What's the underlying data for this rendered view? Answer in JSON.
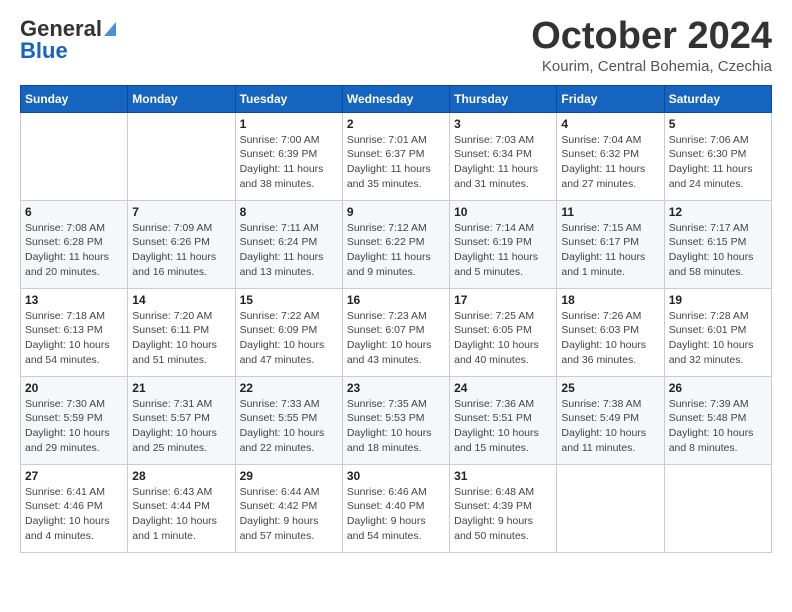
{
  "header": {
    "logo_line1": "General",
    "logo_line2": "Blue",
    "month": "October 2024",
    "location": "Kourim, Central Bohemia, Czechia"
  },
  "weekdays": [
    "Sunday",
    "Monday",
    "Tuesday",
    "Wednesday",
    "Thursday",
    "Friday",
    "Saturday"
  ],
  "weeks": [
    [
      {
        "day": "",
        "info": ""
      },
      {
        "day": "",
        "info": ""
      },
      {
        "day": "1",
        "info": "Sunrise: 7:00 AM\nSunset: 6:39 PM\nDaylight: 11 hours and 38 minutes."
      },
      {
        "day": "2",
        "info": "Sunrise: 7:01 AM\nSunset: 6:37 PM\nDaylight: 11 hours and 35 minutes."
      },
      {
        "day": "3",
        "info": "Sunrise: 7:03 AM\nSunset: 6:34 PM\nDaylight: 11 hours and 31 minutes."
      },
      {
        "day": "4",
        "info": "Sunrise: 7:04 AM\nSunset: 6:32 PM\nDaylight: 11 hours and 27 minutes."
      },
      {
        "day": "5",
        "info": "Sunrise: 7:06 AM\nSunset: 6:30 PM\nDaylight: 11 hours and 24 minutes."
      }
    ],
    [
      {
        "day": "6",
        "info": "Sunrise: 7:08 AM\nSunset: 6:28 PM\nDaylight: 11 hours and 20 minutes."
      },
      {
        "day": "7",
        "info": "Sunrise: 7:09 AM\nSunset: 6:26 PM\nDaylight: 11 hours and 16 minutes."
      },
      {
        "day": "8",
        "info": "Sunrise: 7:11 AM\nSunset: 6:24 PM\nDaylight: 11 hours and 13 minutes."
      },
      {
        "day": "9",
        "info": "Sunrise: 7:12 AM\nSunset: 6:22 PM\nDaylight: 11 hours and 9 minutes."
      },
      {
        "day": "10",
        "info": "Sunrise: 7:14 AM\nSunset: 6:19 PM\nDaylight: 11 hours and 5 minutes."
      },
      {
        "day": "11",
        "info": "Sunrise: 7:15 AM\nSunset: 6:17 PM\nDaylight: 11 hours and 1 minute."
      },
      {
        "day": "12",
        "info": "Sunrise: 7:17 AM\nSunset: 6:15 PM\nDaylight: 10 hours and 58 minutes."
      }
    ],
    [
      {
        "day": "13",
        "info": "Sunrise: 7:18 AM\nSunset: 6:13 PM\nDaylight: 10 hours and 54 minutes."
      },
      {
        "day": "14",
        "info": "Sunrise: 7:20 AM\nSunset: 6:11 PM\nDaylight: 10 hours and 51 minutes."
      },
      {
        "day": "15",
        "info": "Sunrise: 7:22 AM\nSunset: 6:09 PM\nDaylight: 10 hours and 47 minutes."
      },
      {
        "day": "16",
        "info": "Sunrise: 7:23 AM\nSunset: 6:07 PM\nDaylight: 10 hours and 43 minutes."
      },
      {
        "day": "17",
        "info": "Sunrise: 7:25 AM\nSunset: 6:05 PM\nDaylight: 10 hours and 40 minutes."
      },
      {
        "day": "18",
        "info": "Sunrise: 7:26 AM\nSunset: 6:03 PM\nDaylight: 10 hours and 36 minutes."
      },
      {
        "day": "19",
        "info": "Sunrise: 7:28 AM\nSunset: 6:01 PM\nDaylight: 10 hours and 32 minutes."
      }
    ],
    [
      {
        "day": "20",
        "info": "Sunrise: 7:30 AM\nSunset: 5:59 PM\nDaylight: 10 hours and 29 minutes."
      },
      {
        "day": "21",
        "info": "Sunrise: 7:31 AM\nSunset: 5:57 PM\nDaylight: 10 hours and 25 minutes."
      },
      {
        "day": "22",
        "info": "Sunrise: 7:33 AM\nSunset: 5:55 PM\nDaylight: 10 hours and 22 minutes."
      },
      {
        "day": "23",
        "info": "Sunrise: 7:35 AM\nSunset: 5:53 PM\nDaylight: 10 hours and 18 minutes."
      },
      {
        "day": "24",
        "info": "Sunrise: 7:36 AM\nSunset: 5:51 PM\nDaylight: 10 hours and 15 minutes."
      },
      {
        "day": "25",
        "info": "Sunrise: 7:38 AM\nSunset: 5:49 PM\nDaylight: 10 hours and 11 minutes."
      },
      {
        "day": "26",
        "info": "Sunrise: 7:39 AM\nSunset: 5:48 PM\nDaylight: 10 hours and 8 minutes."
      }
    ],
    [
      {
        "day": "27",
        "info": "Sunrise: 6:41 AM\nSunset: 4:46 PM\nDaylight: 10 hours and 4 minutes."
      },
      {
        "day": "28",
        "info": "Sunrise: 6:43 AM\nSunset: 4:44 PM\nDaylight: 10 hours and 1 minute."
      },
      {
        "day": "29",
        "info": "Sunrise: 6:44 AM\nSunset: 4:42 PM\nDaylight: 9 hours and 57 minutes."
      },
      {
        "day": "30",
        "info": "Sunrise: 6:46 AM\nSunset: 4:40 PM\nDaylight: 9 hours and 54 minutes."
      },
      {
        "day": "31",
        "info": "Sunrise: 6:48 AM\nSunset: 4:39 PM\nDaylight: 9 hours and 50 minutes."
      },
      {
        "day": "",
        "info": ""
      },
      {
        "day": "",
        "info": ""
      }
    ]
  ]
}
